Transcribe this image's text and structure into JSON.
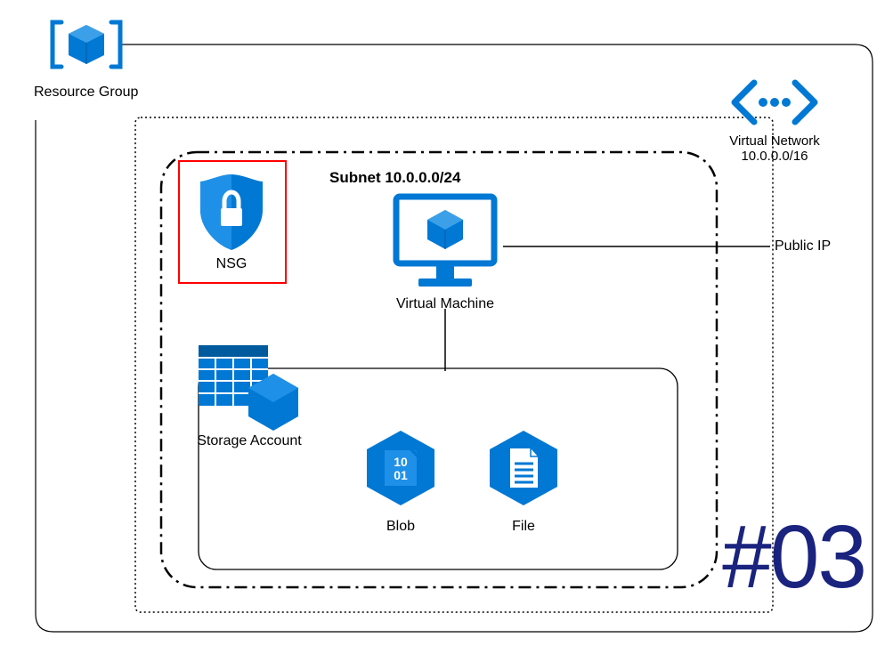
{
  "resourceGroup": {
    "label": "Resource Group"
  },
  "virtualNetwork": {
    "label": "Virtual Network",
    "cidr": "10.0.0.0/16"
  },
  "subnet": {
    "label": "Subnet 10.0.0.0/24"
  },
  "nsg": {
    "label": "NSG"
  },
  "vm": {
    "label": "Virtual Machine"
  },
  "publicIP": {
    "label": "Public IP"
  },
  "storage": {
    "label": "Storage Account"
  },
  "blob": {
    "label": "Blob"
  },
  "file": {
    "label": "File"
  },
  "slideNumber": "#03",
  "highlighted": "nsg"
}
